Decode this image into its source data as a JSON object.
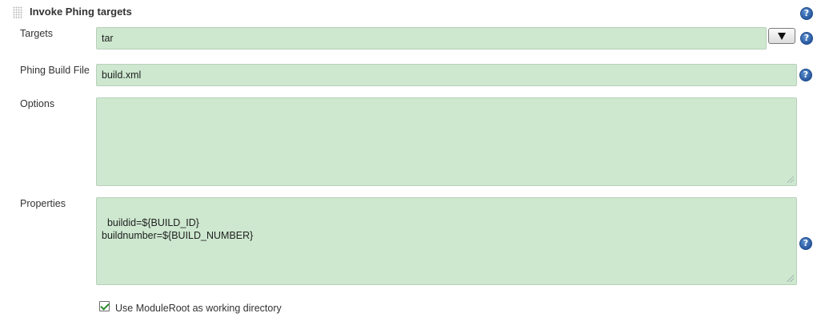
{
  "section": {
    "title": "Invoke Phing targets"
  },
  "targets": {
    "label": "Targets",
    "value": "tar"
  },
  "build_file": {
    "label": "Phing Build File",
    "value": "build.xml"
  },
  "options": {
    "label": "Options",
    "value": ""
  },
  "properties": {
    "label": "Properties",
    "value": "buildid=${BUILD_ID}\nbuildnumber=${BUILD_NUMBER}"
  },
  "module_root": {
    "checked": true,
    "label": "Use ModuleRoot as working directory"
  },
  "icons": {
    "help": "help-icon",
    "dropdown": "dropdown-arrow-icon",
    "drag": "drag-handle-icon",
    "check": "checkmark-icon"
  },
  "colors": {
    "field_bg": "#cde8cf",
    "help_blue": "#2a5aa0"
  },
  "help_glyph": "?"
}
